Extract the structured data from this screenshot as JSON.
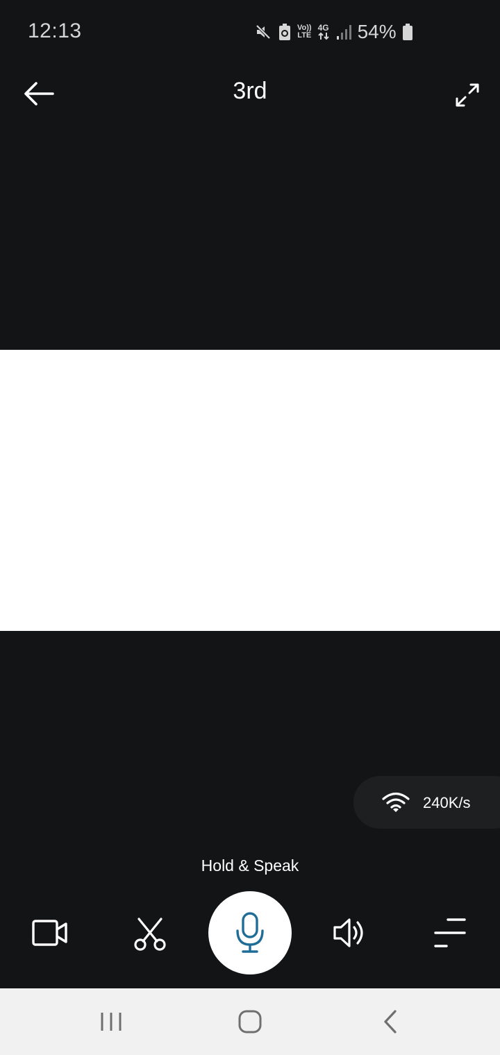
{
  "status_bar": {
    "time": "12:13",
    "volte_top": "Vo))",
    "volte_bottom": "LTE",
    "network_type": "4G",
    "battery_percent": "54%",
    "icons": [
      "mute-icon",
      "battery-saver-icon",
      "volte-icon",
      "4g-data-icon",
      "signal-icon",
      "battery-icon"
    ]
  },
  "header": {
    "title": "3rd",
    "back_icon": "arrow-left-icon",
    "fullscreen_icon": "expand-icon"
  },
  "network": {
    "speed": "240K/s",
    "icon": "wifi-icon"
  },
  "talk": {
    "label": "Hold & Speak"
  },
  "controls": [
    "record-video-icon",
    "scissors-icon",
    "microphone-icon",
    "speaker-icon",
    "menu-lines-icon"
  ],
  "colors": {
    "background": "#131416",
    "video_area": "#ffffff",
    "accent_mic": "#1f6d97",
    "nav_bar": "#f1f1f1",
    "pill": "#1e1f21"
  }
}
